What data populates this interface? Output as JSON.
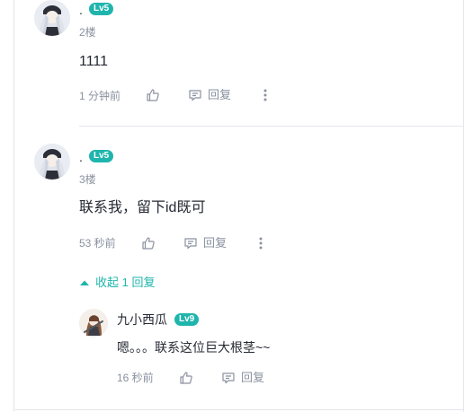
{
  "comments": [
    {
      "username": ".",
      "level": "Lv5",
      "floor": "2楼",
      "content": "1111",
      "time": "1 分钟前",
      "reply_label": "回复"
    },
    {
      "username": ".",
      "level": "Lv5",
      "floor": "3楼",
      "content": "联系我，留下id既可",
      "time": "53 秒前",
      "reply_label": "回复",
      "collapse_label": "收起 1 回复",
      "replies": [
        {
          "username": "九小西瓜",
          "level": "Lv9",
          "content": "嗯。。。联系这位巨大根茎~~",
          "time": "16 秒前",
          "reply_label": "回复"
        }
      ]
    }
  ],
  "colors": {
    "accent": "#1fb5ad",
    "muted": "#8a919f",
    "text": "#252933",
    "border": "#e4e6eb"
  },
  "icons": [
    "like-icon",
    "comment-icon",
    "more-icon",
    "caret-up-icon"
  ]
}
